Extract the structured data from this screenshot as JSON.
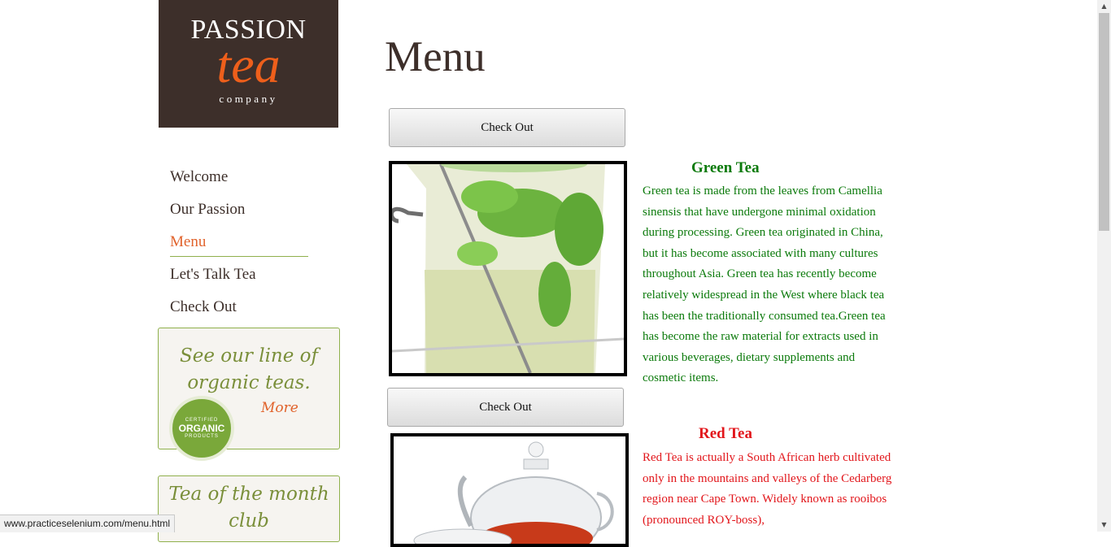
{
  "logo": {
    "line1": "PASSION",
    "line2": "tea",
    "line3": "company"
  },
  "nav": {
    "items": [
      {
        "label": "Welcome"
      },
      {
        "label": "Our Passion"
      },
      {
        "label": "Menu"
      },
      {
        "label": "Let's Talk Tea"
      },
      {
        "label": "Check Out"
      }
    ],
    "active": "Menu"
  },
  "promo1": {
    "text": "See our line of organic teas.",
    "more": "More",
    "badge_top": "CERTIFIED",
    "badge_main": "ORGANIC",
    "badge_bottom": "PRODUCTS"
  },
  "promo2": {
    "text": "Tea of the month club"
  },
  "page_title": "Menu",
  "checkout_label": "Check Out",
  "green_tea": {
    "title": "Green Tea",
    "description": "Green tea is made from the leaves from Camellia sinensis that have undergone minimal oxidation during processing. Green tea originated in China, but it has become associated with many cultures throughout Asia. Green tea has recently become relatively widespread in the West where black tea has been the traditionally consumed tea.Green tea has become the raw material for extracts used in various beverages, dietary supplements and cosmetic items."
  },
  "red_tea": {
    "title": "Red Tea",
    "description": "Red Tea is actually a South African herb cultivated only in the mountains and valleys of the Cedarberg region near Cape Town. Widely known as rooibos (pronounced ROY-boss),"
  },
  "status_url": "www.practiceselenium.com/menu.html",
  "colors": {
    "brand_dark": "#3d2f2a",
    "accent_orange": "#e1632c",
    "green_text": "#0b7a0b",
    "red_text": "#e2161b",
    "promo_border": "#8fb04c"
  }
}
